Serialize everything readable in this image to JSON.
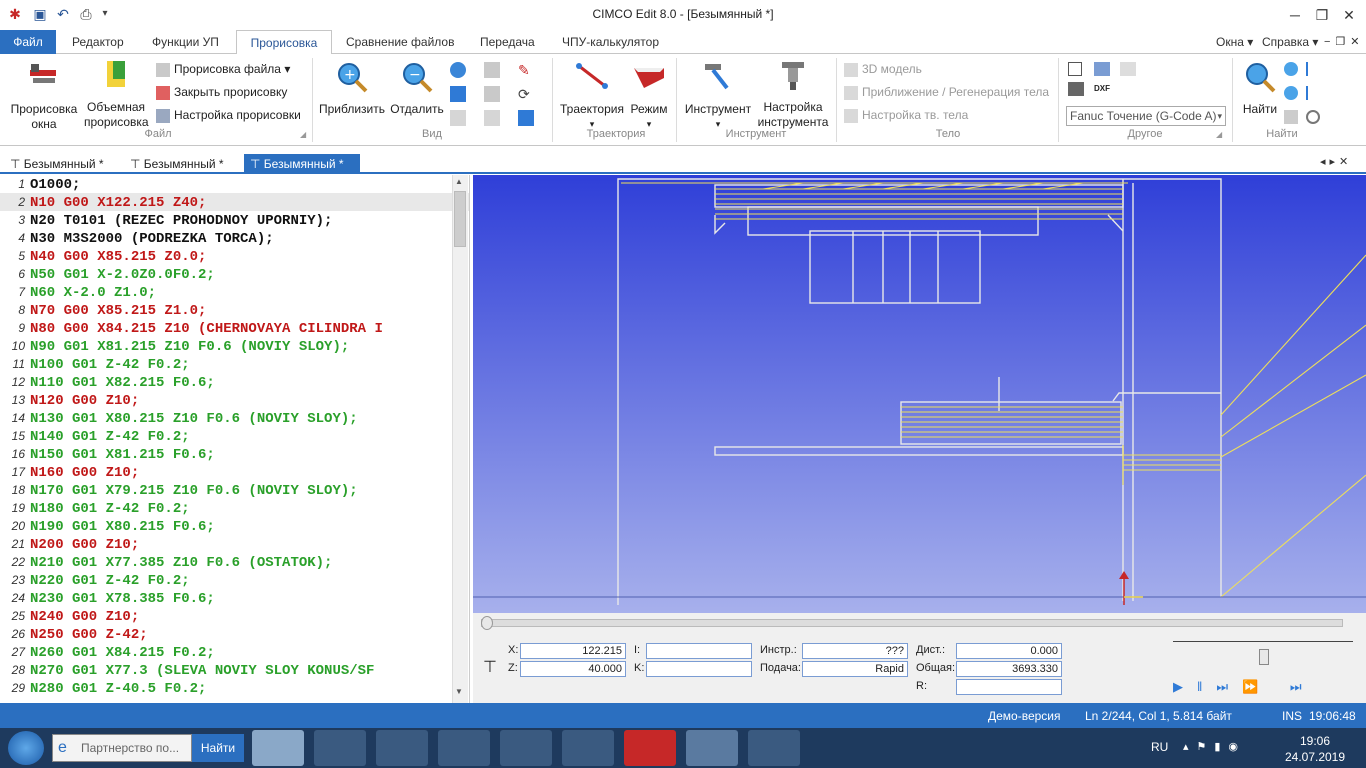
{
  "window": {
    "title": "CIMCO Edit 8.0 - [Безымянный *]"
  },
  "ribbon_tabs": [
    {
      "label": "Файл"
    },
    {
      "label": "Редактор"
    },
    {
      "label": "Функции УП"
    },
    {
      "label": "Прорисовка"
    },
    {
      "label": "Сравнение файлов"
    },
    {
      "label": "Передача"
    },
    {
      "label": "ЧПУ-калькулятор"
    }
  ],
  "right_menus": {
    "windows": "Окна",
    "help": "Справка"
  },
  "ribbon": {
    "group_file": {
      "label": "Файл",
      "window_draw": "Прорисовка окна",
      "solid_draw": "Объемная прорисовка",
      "draw_file": "Прорисовка файла",
      "close_draw": "Закрыть прорисовку",
      "draw_settings": "Настройка прорисовки"
    },
    "group_view": {
      "label": "Вид",
      "zoom_in": "Приблизить",
      "zoom_out": "Отдалить"
    },
    "group_trajectory": {
      "label": "Траектория",
      "trajectory": "Траектория",
      "mode": "Режим"
    },
    "group_tool": {
      "label": "Инструмент",
      "tool": "Инструмент",
      "tool_settings": "Настройка инструмента"
    },
    "group_body": {
      "label": "Тело",
      "model3d": "3D модель",
      "approx": "Приближение / Регенерация тела",
      "body_settings": "Настройка тв. тела"
    },
    "group_other": {
      "label": "Другое",
      "machine_select": "Fanuc Точение (G-Code A)"
    },
    "group_find": {
      "label": "Найти",
      "find": "Найти"
    }
  },
  "doc_tabs": [
    {
      "label": "Безымянный *"
    },
    {
      "label": "Безымянный *"
    },
    {
      "label": "Безымянный *"
    }
  ],
  "code_lines": [
    {
      "n": "1",
      "text": "O1000;",
      "color": "#111111"
    },
    {
      "n": "2",
      "text": "N10 G00 X122.215 Z40;",
      "color": "#c01818"
    },
    {
      "n": "3",
      "text": "N20 T0101 (REZEC PROHODNOY UPORNIY);",
      "color": "#111111"
    },
    {
      "n": "4",
      "text": "N30 M3S2000 (PODREZKA TORCA);",
      "color": "#111111"
    },
    {
      "n": "5",
      "text": "N40 G00 X85.215 Z0.0;",
      "color": "#c01818"
    },
    {
      "n": "6",
      "text": "N50 G01 X-2.0Z0.0F0.2;",
      "color": "#2aa02a"
    },
    {
      "n": "7",
      "text": "N60 X-2.0 Z1.0;",
      "color": "#2aa02a"
    },
    {
      "n": "8",
      "text": "N70 G00 X85.215 Z1.0;",
      "color": "#c01818"
    },
    {
      "n": "9",
      "text": "N80 G00 X84.215 Z10 (CHERNOVAYA CILINDRA I",
      "color": "#c01818"
    },
    {
      "n": "10",
      "text": "N90 G01 X81.215 Z10 F0.6 (NOVIY SLOY);",
      "color": "#2aa02a"
    },
    {
      "n": "11",
      "text": "N100 G01 Z-42 F0.2;",
      "color": "#2aa02a"
    },
    {
      "n": "12",
      "text": "N110 G01 X82.215 F0.6;",
      "color": "#2aa02a"
    },
    {
      "n": "13",
      "text": "N120 G00 Z10;",
      "color": "#c01818"
    },
    {
      "n": "14",
      "text": "N130 G01 X80.215 Z10 F0.6 (NOVIY SLOY);",
      "color": "#2aa02a"
    },
    {
      "n": "15",
      "text": "N140 G01 Z-42 F0.2;",
      "color": "#2aa02a"
    },
    {
      "n": "16",
      "text": "N150 G01 X81.215 F0.6;",
      "color": "#2aa02a"
    },
    {
      "n": "17",
      "text": "N160 G00 Z10;",
      "color": "#c01818"
    },
    {
      "n": "18",
      "text": "N170 G01 X79.215 Z10 F0.6 (NOVIY SLOY);",
      "color": "#2aa02a"
    },
    {
      "n": "19",
      "text": "N180 G01 Z-42 F0.2;",
      "color": "#2aa02a"
    },
    {
      "n": "20",
      "text": "N190 G01 X80.215 F0.6;",
      "color": "#2aa02a"
    },
    {
      "n": "21",
      "text": "N200 G00 Z10;",
      "color": "#c01818"
    },
    {
      "n": "22",
      "text": "N210 G01 X77.385 Z10 F0.6 (OSTATOK);",
      "color": "#2aa02a"
    },
    {
      "n": "23",
      "text": "N220 G01 Z-42 F0.2;",
      "color": "#2aa02a"
    },
    {
      "n": "24",
      "text": "N230 G01 X78.385 F0.6;",
      "color": "#2aa02a"
    },
    {
      "n": "25",
      "text": "N240 G00 Z10;",
      "color": "#c01818"
    },
    {
      "n": "26",
      "text": "N250 G00 Z-42;",
      "color": "#c01818"
    },
    {
      "n": "27",
      "text": "N260 G01 X84.215 F0.2;",
      "color": "#2aa02a"
    },
    {
      "n": "28",
      "text": "N270 G01 X77.3 (SLEVA NOVIY SLOY KONUS/SF",
      "color": "#2aa02a"
    },
    {
      "n": "29",
      "text": "N280 G01 Z-40.5 F0.2;",
      "color": "#2aa02a"
    }
  ],
  "panel": {
    "x_label": "X:",
    "x_value": "122.215",
    "z_label": "Z:",
    "z_value": "40.000",
    "i_label": "I:",
    "k_label": "K:",
    "tool_label": "Инстр.:",
    "tool_value": "???",
    "feed_label": "Подача:",
    "feed_value": "Rapid",
    "dist_label": "Дист.:",
    "dist_value": "0.000",
    "total_label": "Общая:",
    "total_value": "3693.330",
    "r_label": "R:"
  },
  "status": {
    "demo": "Демо-версия",
    "position": "Ln 2/244, Col 1, 5.814 байт",
    "ins": "INS",
    "time": "19:06:48"
  },
  "taskbar": {
    "search_placeholder": "Партнерство по...",
    "search_button": "Найти",
    "lang": "RU",
    "clock_time": "19:06",
    "clock_date": "24.07.2019"
  }
}
